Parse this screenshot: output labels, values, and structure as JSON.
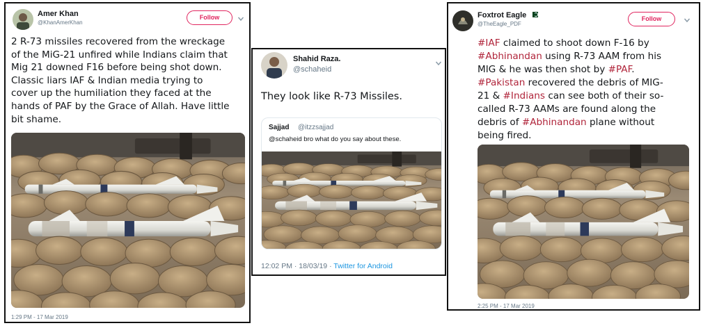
{
  "tweet_left": {
    "display_name": "Amer Khan",
    "handle": "@KhanAmerKhan",
    "follow_label": "Follow",
    "text_lines": [
      "2 R-73 missiles recovered from the wreckage",
      "of the MiG-21 unfired while Indians claim that",
      "Mig 21 downed F16 before being shot down.",
      "Classic liars IAF & Indian media trying to",
      "cover up the humiliation they faced at the",
      "hands of PAF by the Grace of Allah. Have little",
      "bit shame."
    ],
    "timestamp": "1:29 PM - 17 Mar 2019"
  },
  "tweet_middle": {
    "display_name": "Shahid Raza.",
    "handle": "@schaheid",
    "text": "They look like R-73 Missiles.",
    "quoted": {
      "display_name": "Sajjad",
      "handle": "@itzzsajjad",
      "text": "@schaheid  bro what do you say about these."
    },
    "timestamp": "12:02 PM · 18/03/19 · ",
    "via": "Twitter for Android"
  },
  "tweet_right": {
    "display_name": "Foxtrot Eagle",
    "handle": "@TheEagle_PDF",
    "follow_label": "Follow",
    "text_lines": [
      [
        {
          "t": "#IAF",
          "h": true
        },
        {
          "t": " claimed to shoot down F-16 by",
          "h": false
        }
      ],
      [
        {
          "t": "#Abhinandan",
          "h": true
        },
        {
          "t": " using R-73 AAM from his",
          "h": false
        }
      ],
      [
        {
          "t": "MIG & he was then shot by ",
          "h": false
        },
        {
          "t": "#PAF",
          "h": true
        },
        {
          "t": ".",
          "h": false
        }
      ],
      [
        {
          "t": "#Pakistan",
          "h": true
        },
        {
          "t": " recovered the debris of MIG-",
          "h": false
        }
      ],
      [
        {
          "t": "21 & ",
          "h": false
        },
        {
          "t": "#Indians",
          "h": true
        },
        {
          "t": " can see both of their so-",
          "h": false
        }
      ],
      [
        {
          "t": "called R-73 AAMs are found along the",
          "h": false
        }
      ],
      [
        {
          "t": "debris of ",
          "h": false
        },
        {
          "t": "#Abhinandan",
          "h": true
        },
        {
          "t": " plane without",
          "h": false
        }
      ],
      [
        {
          "t": "being fired.",
          "h": false
        }
      ]
    ],
    "timestamp": "2:25 PM - 17 Mar 2019"
  },
  "colors": {
    "hashtag": "#b0243a",
    "follow_accent": "#e0245e",
    "link": "#1b95e0",
    "muted": "#657786"
  },
  "icons": [
    "chevron-down-icon",
    "pakistan-flag-icon"
  ]
}
